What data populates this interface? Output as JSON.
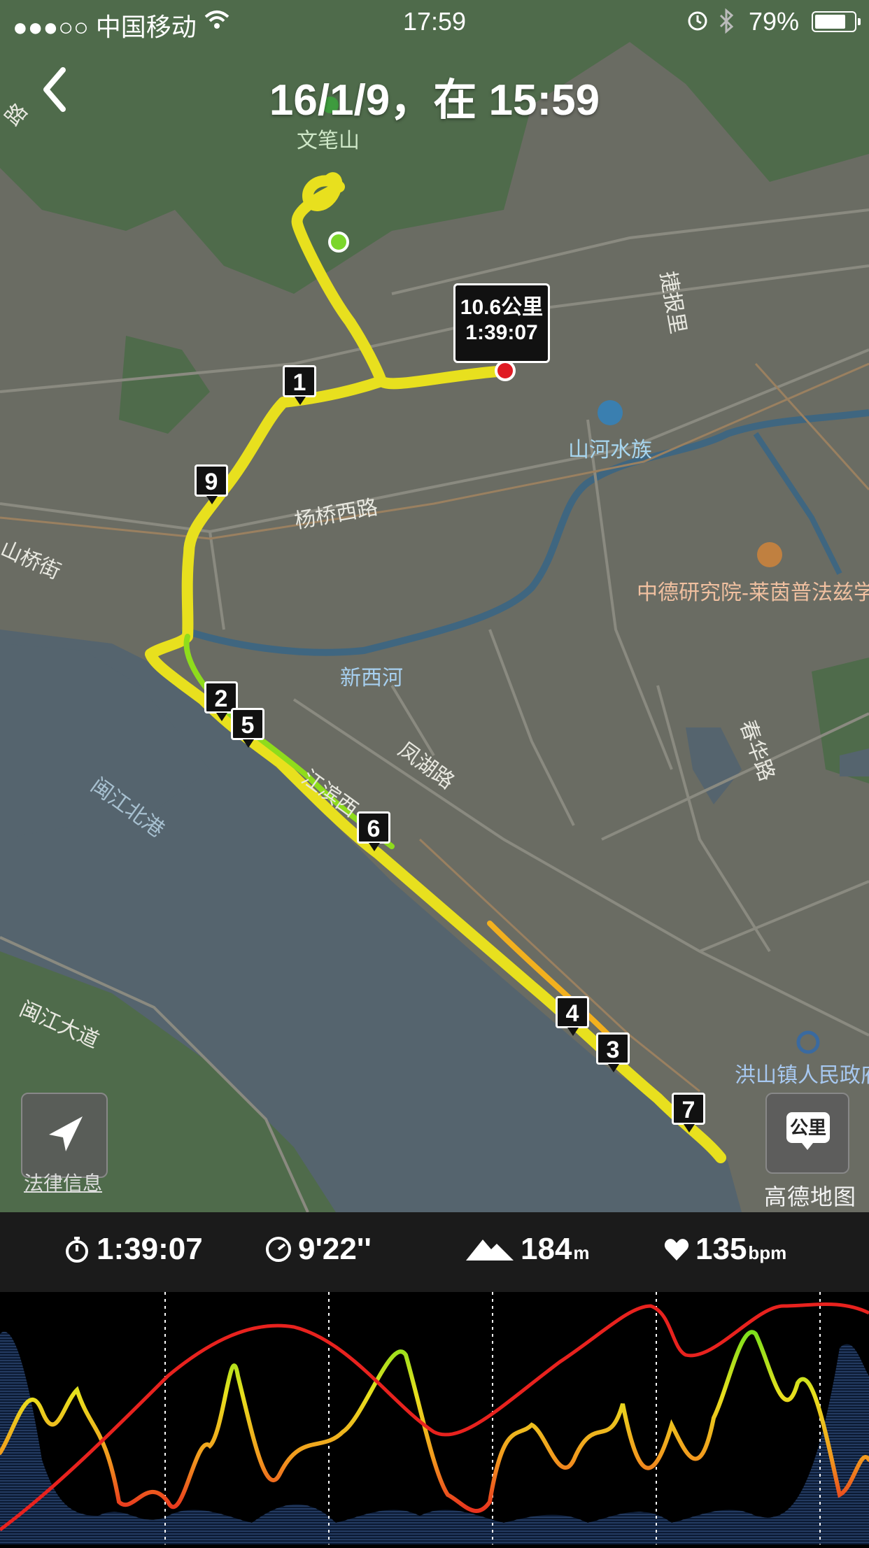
{
  "status_bar": {
    "carrier": "●●●○○ 中国移动",
    "time": "17:59",
    "battery_percent": "79%",
    "battery_level": 0.79
  },
  "header": {
    "title": "16/1/9，在 15:59"
  },
  "map": {
    "labels": {
      "wenbi_shan": "文笔山",
      "shanhe_shuizu": "山河水族",
      "yangqiao_xilu": "杨桥西路",
      "zhongde": "中德研究院-莱茵普法兹学",
      "xinxihe": "新西河",
      "fenghu_lu": "凤湖路",
      "jiangbin": "江滨西",
      "minjiang_beigang": "闽江北港",
      "minjiang_dadao": "闽江大道",
      "hongshan": "洪山镇人民政府",
      "chunhua_lu": "春华路",
      "jiebao_li": "捷报里",
      "shanqiao_jie": "山桥街",
      "road_top_left": "路"
    },
    "end_callout": {
      "distance": "10.6公里",
      "duration": "1:39:07"
    },
    "km_markers": [
      "1",
      "2",
      "3",
      "4",
      "5",
      "6",
      "7",
      "9"
    ],
    "legal_link": "法律信息",
    "unit_toggle": "公里",
    "provider_logo": "高德地图",
    "colors": {
      "route_fast": "#7de01c",
      "route_medium": "#e8e01e",
      "route_slow": "#f4a41c",
      "start_point": "#7bd62a",
      "end_point": "#e01b24",
      "water": "#55646e",
      "land": "#6a6c63",
      "park": "#4f6b4b"
    }
  },
  "stats": {
    "duration": "1:39:07",
    "pace": "9'22''",
    "elevation": "184",
    "elevation_unit": "m",
    "heart_rate": "135",
    "heart_rate_unit": "bpm"
  },
  "icons": [
    "back-chevron-icon",
    "wifi-icon",
    "alarm-icon",
    "bluetooth-icon",
    "stopwatch-icon",
    "pace-gauge-icon",
    "mountain-icon",
    "heart-icon",
    "location-arrow-icon"
  ]
}
